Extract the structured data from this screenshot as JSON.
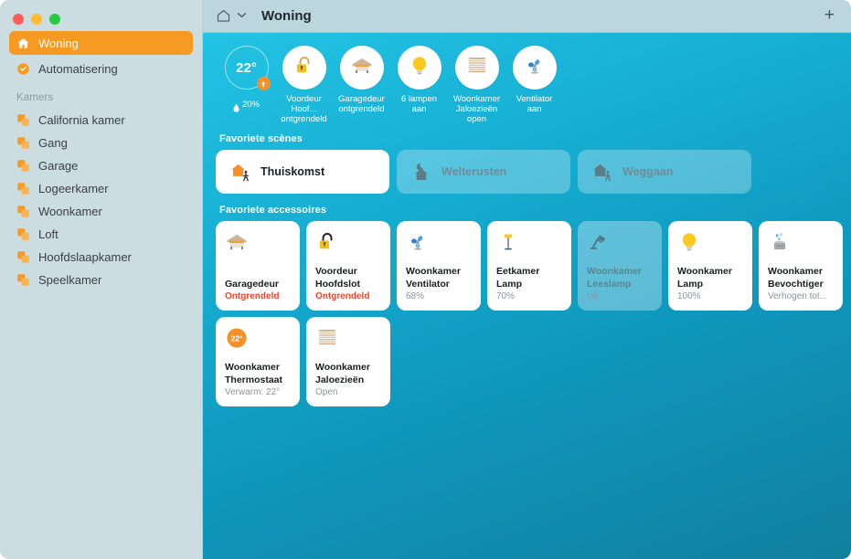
{
  "window": {
    "traffic_lights": [
      "close",
      "minimize",
      "zoom"
    ]
  },
  "sidebar": {
    "primary": [
      {
        "label": "Woning",
        "icon": "home-icon",
        "selected": true
      },
      {
        "label": "Automatisering",
        "icon": "automation-icon",
        "selected": false
      }
    ],
    "section_header": "Kamers",
    "rooms": [
      {
        "label": "California kamer",
        "icon": "room-icon"
      },
      {
        "label": "Gang",
        "icon": "room-icon"
      },
      {
        "label": "Garage",
        "icon": "room-icon"
      },
      {
        "label": "Logeerkamer",
        "icon": "room-icon"
      },
      {
        "label": "Woonkamer",
        "icon": "room-icon"
      },
      {
        "label": "Loft",
        "icon": "room-icon"
      },
      {
        "label": "Hoofdslaapkamer",
        "icon": "room-icon"
      },
      {
        "label": "Speelkamer",
        "icon": "room-icon"
      }
    ]
  },
  "toolbar": {
    "home_icon": "home-outline-icon",
    "chevron_icon": "chevron-down-icon",
    "title": "Woning",
    "add_label": "+"
  },
  "status_strip": [
    {
      "type": "temperature",
      "value": "22°",
      "badge_icon": "arrow-up-icon",
      "sub_icon": "humidity-drop-icon",
      "sub": "20%"
    },
    {
      "type": "icon",
      "icon": "lock-open-icon",
      "sub": "Voordeur Hoof...\nontgrendeld"
    },
    {
      "type": "icon",
      "icon": "garage-door-icon",
      "sub": "Garagedeur\nontgrendeld"
    },
    {
      "type": "icon",
      "icon": "lightbulb-icon",
      "sub": "6 lampen\naan"
    },
    {
      "type": "icon",
      "icon": "blinds-icon",
      "sub": "Woonkamer\nJaloezieën open"
    },
    {
      "type": "icon",
      "icon": "fan-icon",
      "sub": "Ventilator\naan"
    }
  ],
  "scenes_section": {
    "title": "Favoriete scènes",
    "items": [
      {
        "label": "Thuiskomst",
        "icon": "house-arriving-icon",
        "active": true
      },
      {
        "label": "Welterusten",
        "icon": "moon-house-icon",
        "active": false
      },
      {
        "label": "Weggaan",
        "icon": "house-leaving-icon",
        "active": false
      }
    ]
  },
  "accessories_section": {
    "title": "Favoriete accessoires",
    "items": [
      {
        "icon": "garage-door-icon",
        "name": "Garagedeur",
        "state": "Ontgrendeld",
        "alert": true,
        "active": true
      },
      {
        "icon": "lock-open-icon",
        "name": "Voordeur Hoofdslot",
        "state": "Ontgrendeld",
        "alert": true,
        "active": true
      },
      {
        "icon": "fan-icon",
        "name": "Woonkamer Ventilator",
        "state": "68%",
        "alert": false,
        "active": true
      },
      {
        "icon": "floor-lamp-icon",
        "name": "Eetkamer Lamp",
        "state": "70%",
        "alert": false,
        "active": true
      },
      {
        "icon": "desk-lamp-icon",
        "name": "Woonkamer Leeslamp",
        "state": "Uit",
        "alert": false,
        "active": false
      },
      {
        "icon": "lightbulb-icon",
        "name": "Woonkamer Lamp",
        "state": "100%",
        "alert": false,
        "active": true
      },
      {
        "icon": "humidifier-icon",
        "name": "Woonkamer Bevochtiger",
        "state": "Verhogen tot...",
        "alert": false,
        "active": true
      },
      {
        "icon": "thermostat-icon",
        "name": "Woonkamer Thermostaat",
        "state": "Verwarm: 22°",
        "alert": false,
        "active": true,
        "badge": "22°"
      },
      {
        "icon": "blinds-icon",
        "name": "Woonkamer Jaloezieën",
        "state": "Open",
        "alert": false,
        "active": true
      }
    ]
  },
  "colors": {
    "accent_orange": "#f79a23",
    "alert_red": "#f2452f",
    "bg_top": "#25c6e6",
    "bg_bottom": "#11809f",
    "sidebar_bg": "#ccdde2",
    "toolbar_bg": "#bcd6de"
  }
}
